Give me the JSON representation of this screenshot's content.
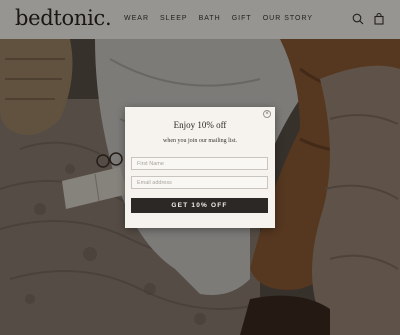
{
  "header": {
    "logo": "bedtonic.",
    "nav": [
      "WEAR",
      "SLEEP",
      "BATH",
      "GIFT",
      "OUR STORY"
    ],
    "icons": {
      "search": "search-icon",
      "bag": "shopping-bag-icon"
    }
  },
  "modal": {
    "title": "Enjoy 10% off",
    "subtitle": "when you join our mailing list.",
    "name_placeholder": "First Name",
    "email_placeholder": "Email address",
    "submit_label": "GET 10% OFF",
    "close_icon": "close-icon"
  },
  "colors": {
    "header_bg": "#f4f1ec",
    "modal_bg": "#f6f3ee",
    "button_bg": "#2b2826"
  }
}
